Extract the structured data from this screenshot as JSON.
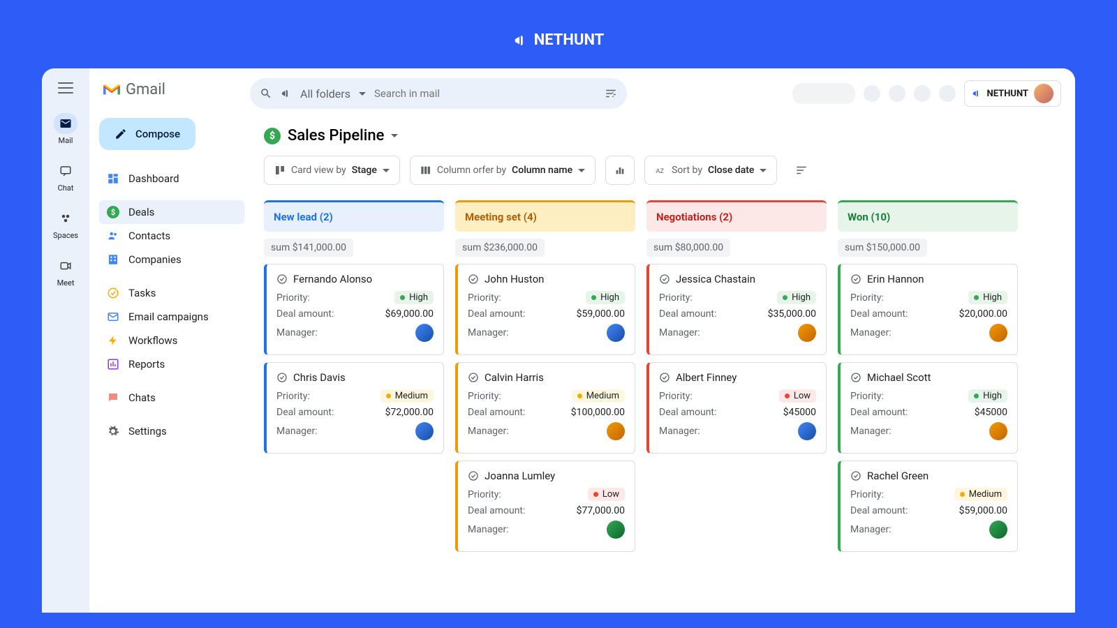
{
  "brand": {
    "top_logo": "NETHUNT",
    "badge": "NETHUNT",
    "gmail": "Gmail"
  },
  "rail": [
    {
      "label": "Mail",
      "icon": "mail-icon",
      "active": true
    },
    {
      "label": "Chat",
      "icon": "chat-icon"
    },
    {
      "label": "Spaces",
      "icon": "spaces-icon"
    },
    {
      "label": "Meet",
      "icon": "meet-icon"
    }
  ],
  "compose": "Compose",
  "nav": {
    "group1": [
      {
        "label": "Dashboard",
        "icon": "dashboard-icon"
      }
    ],
    "group2": [
      {
        "label": "Deals",
        "icon": "dollar-icon",
        "active": true
      },
      {
        "label": "Contacts",
        "icon": "people-icon"
      },
      {
        "label": "Companies",
        "icon": "building-icon"
      }
    ],
    "group3": [
      {
        "label": "Tasks",
        "icon": "check-circle-icon"
      },
      {
        "label": "Email campaigns",
        "icon": "envelope-icon"
      },
      {
        "label": "Workflows",
        "icon": "bolt-icon"
      },
      {
        "label": "Reports",
        "icon": "chart-icon"
      }
    ],
    "group4": [
      {
        "label": "Chats",
        "icon": "chat-bubble-icon"
      }
    ],
    "group5": [
      {
        "label": "Settings",
        "icon": "gear-icon"
      }
    ]
  },
  "search": {
    "folders_label": "All folders",
    "placeholder": "Search in mail"
  },
  "pipeline": {
    "title": "Sales Pipeline"
  },
  "controls": {
    "card_view_prefix": "Card view by",
    "card_view_value": "Stage",
    "column_order_prefix": "Column orfer by",
    "column_order_value": "Column name",
    "sort_prefix": "Sort by",
    "sort_value": "Close date"
  },
  "labels": {
    "priority": "Priority:",
    "deal_amount": "Deal amount:",
    "manager": "Manager:"
  },
  "columns": [
    {
      "title": "New lead (2)",
      "sum": "sum $141,000.00",
      "cards": [
        {
          "name": "Fernando Alonso",
          "priority": "High",
          "amount": "$69,000.00",
          "av": "av1"
        },
        {
          "name": "Chris Davis",
          "priority": "Medium",
          "amount": "$72,000.00",
          "av": "av1"
        }
      ]
    },
    {
      "title": "Meeting set (4)",
      "sum": "sum $236,000.00",
      "cards": [
        {
          "name": "John Huston",
          "priority": "High",
          "amount": "$59,000.00",
          "av": "av1"
        },
        {
          "name": "Calvin Harris",
          "priority": "Medium",
          "amount": "$100,000.00",
          "av": "av2"
        },
        {
          "name": "Joanna Lumley",
          "priority": "Low",
          "amount": "$77,000.00",
          "av": "av3"
        }
      ]
    },
    {
      "title": "Negotiations (2)",
      "sum": "sum $80,000.00",
      "cards": [
        {
          "name": "Jessica Chastain",
          "priority": "High",
          "amount": "$35,000.00",
          "av": "av2"
        },
        {
          "name": "Albert Finney",
          "priority": "Low",
          "amount": "$45000",
          "av": "av1"
        }
      ]
    },
    {
      "title": "Won (10)",
      "sum": "sum $150,000.00",
      "cards": [
        {
          "name": "Erin Hannon",
          "priority": "High",
          "amount": "$20,000.00",
          "av": "av2"
        },
        {
          "name": "Michael Scott",
          "priority": "High",
          "amount": "$45000",
          "av": "av2"
        },
        {
          "name": "Rachel Green",
          "priority": "Medium",
          "amount": "$59,000.00",
          "av": "av3"
        }
      ]
    }
  ]
}
